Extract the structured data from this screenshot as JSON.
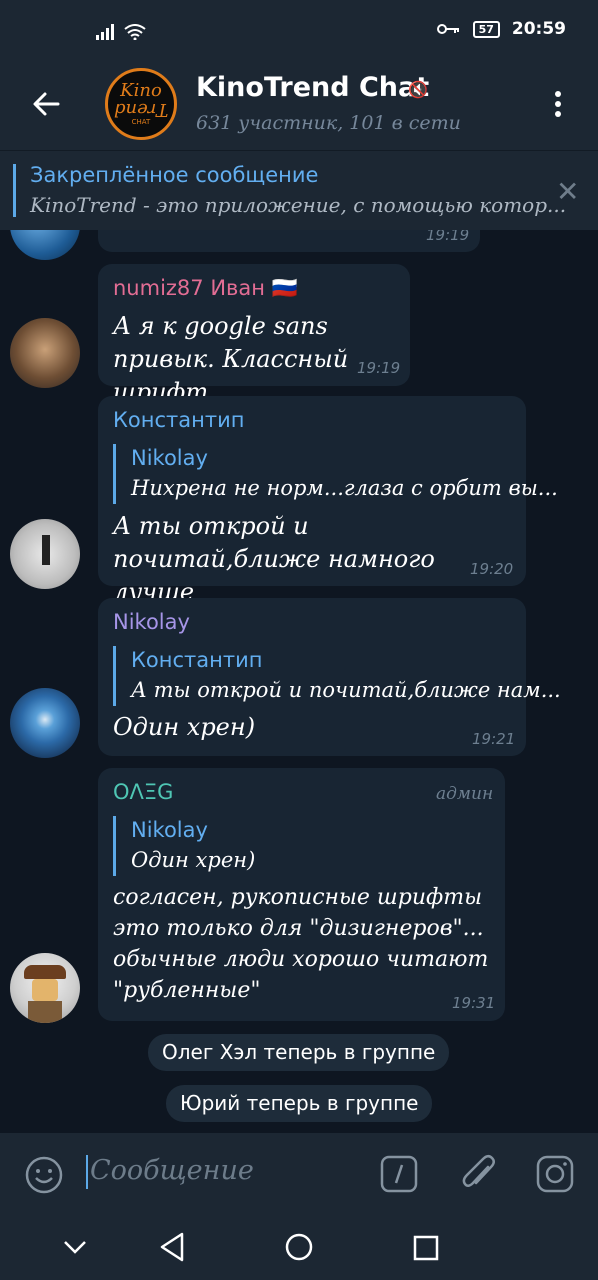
{
  "status": {
    "time": "20:59",
    "battery": "57"
  },
  "header": {
    "title": "KinoTrend Chat",
    "subtitle": "631 участник, 101 в сети",
    "avatar_text_top": "Kino",
    "avatar_text_mid": "Trend",
    "avatar_text_bottom": "CHAT"
  },
  "pinned": {
    "label": "Закреплённое сообщение",
    "text": "KinoTrend - это приложение, с помощью котор..."
  },
  "messages": [
    {
      "time": "19:19"
    },
    {
      "author": "numiz87 Иван 🇷🇺",
      "text": "А я к google sans привык. Классный шрифт",
      "time": "19:19"
    },
    {
      "author": "Константип",
      "reply_name": "Nikolay",
      "reply_text": "Нихрена не норм...глаза с орбит вы...",
      "text": "А ты открой и почитай,ближе намного лучше",
      "time": "19:20"
    },
    {
      "author": "Nikolay",
      "reply_name": "Константип",
      "reply_text": "А ты открой и почитай,ближе нам...",
      "text": "Один хрен)",
      "time": "19:21"
    },
    {
      "author": "OΛΞG",
      "badge": "админ",
      "reply_name": "Nikolay",
      "reply_text": "Один хрен)",
      "text": "согласен, рукописные шрифты это только для \"дизигнеров\"... обычные люди хорошо читают \"рубленные\"",
      "time": "19:31"
    }
  ],
  "service": [
    "Олег Хэл теперь в группе",
    "Юрий теперь в группе"
  ],
  "input": {
    "placeholder": "Сообщение"
  },
  "colors": {
    "bg": "#0e1621",
    "bar": "#1c2733",
    "bubble": "#182533",
    "accent": "#5ca9e8"
  }
}
